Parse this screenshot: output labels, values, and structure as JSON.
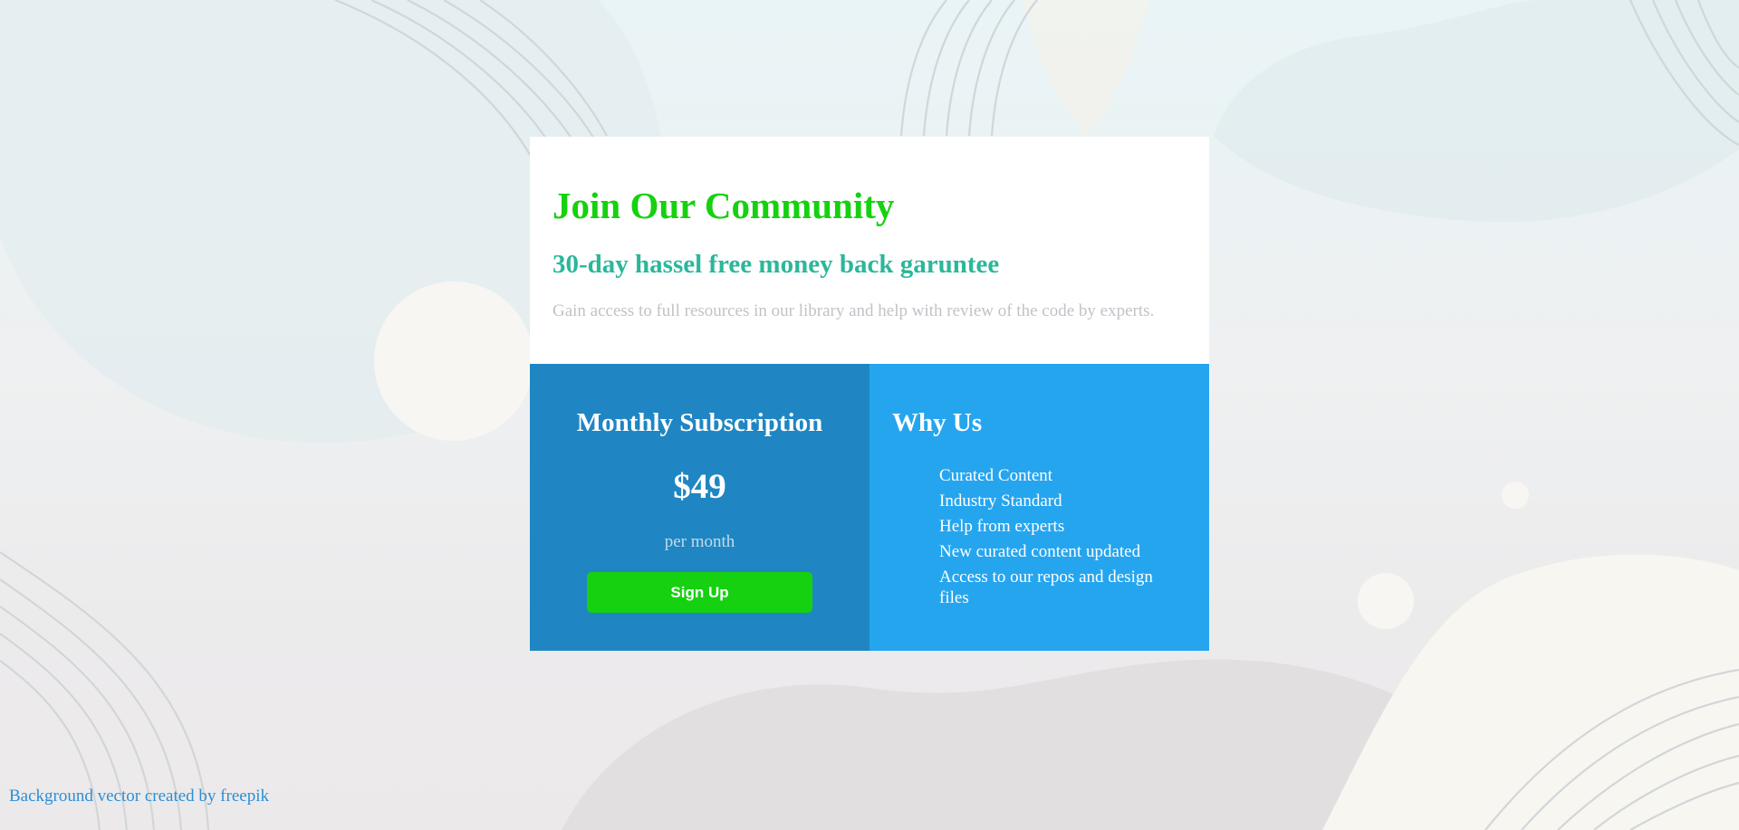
{
  "card": {
    "title": "Join Our Community",
    "subtitle": "30-day hassel free money back garuntee",
    "description": "Gain access to full resources in our library and help with review of the code by experts."
  },
  "subscription": {
    "title": "Monthly Subscription",
    "price": "$49",
    "period": "per month",
    "button_label": "Sign Up"
  },
  "why_us": {
    "title": "Why Us",
    "items": [
      "Curated Content",
      "Industry Standard",
      "Help from experts",
      "New curated content updated",
      "Access to our repos and design files"
    ]
  },
  "footer": {
    "credit": "Background vector created by freepik"
  },
  "colors": {
    "title_green": "#15d10f",
    "subtitle_teal": "#2bb79a",
    "left_panel": "#1f86c3",
    "right_panel": "#26a5ef",
    "button": "#15d10f",
    "link": "#2a8fd6"
  }
}
